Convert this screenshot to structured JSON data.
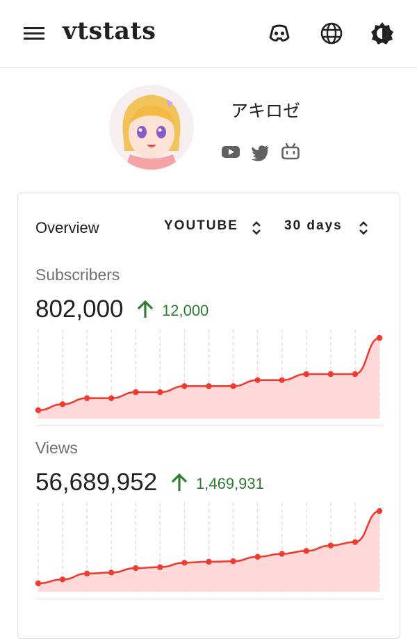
{
  "header": {
    "title": "vtstats",
    "icons": [
      "menu-icon",
      "discord-icon",
      "globe-icon",
      "brightness-icon"
    ]
  },
  "profile": {
    "name": "アキロゼ",
    "social_icons": [
      "youtube-icon",
      "twitter-icon",
      "bilibili-icon"
    ]
  },
  "overview": {
    "label": "Overview",
    "platform": "YOUTUBE",
    "range": "30 days"
  },
  "stats": [
    {
      "label": "Subscribers",
      "value": "802,000",
      "delta": "12,000"
    },
    {
      "label": "Views",
      "value": "56,689,952",
      "delta": "1,469,931"
    }
  ],
  "colors": {
    "line": "#ef3b30",
    "fill": "#ffd5d5",
    "delta": "#2e7d32"
  },
  "chart_data": [
    {
      "type": "area",
      "series": [
        {
          "values": [
            790000,
            791000,
            792000,
            792000,
            793000,
            793000,
            794000,
            794000,
            794000,
            795000,
            795000,
            796000,
            796000,
            796000,
            802000
          ]
        }
      ]
    },
    {
      "type": "area",
      "series": [
        {
          "values": [
            55220021,
            55300000,
            55420000,
            55440000,
            55530000,
            55550000,
            55640000,
            55660000,
            55670000,
            55760000,
            55820000,
            55880000,
            55990000,
            56060000,
            56689952
          ]
        }
      ]
    }
  ]
}
